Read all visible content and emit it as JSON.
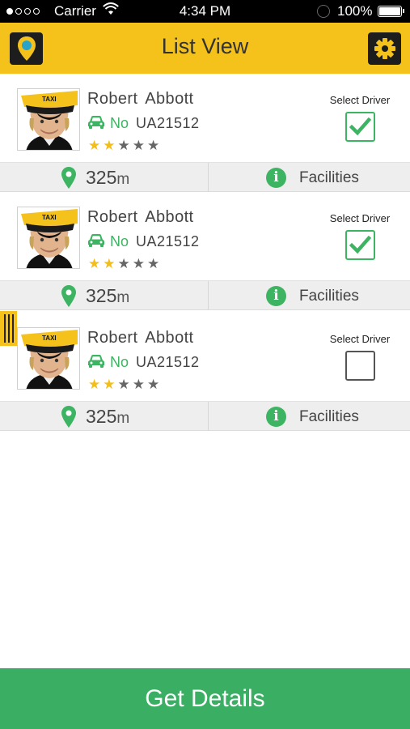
{
  "status_bar": {
    "carrier": "Carrier",
    "time": "4:34 PM",
    "battery": "100%"
  },
  "header": {
    "title": "List View",
    "left_icon": "map-pin-icon",
    "right_icon": "gear-icon"
  },
  "drivers": [
    {
      "name": "Robert  Abbott",
      "availability": "No",
      "plate": "UA21512",
      "rating": 2,
      "rating_max": 5,
      "select_label": "Select Driver",
      "selected": true,
      "distance": "325",
      "distance_unit": "m",
      "facilities_label": "Facilities"
    },
    {
      "name": "Robert  Abbott",
      "availability": "No",
      "plate": "UA21512",
      "rating": 2,
      "rating_max": 5,
      "select_label": "Select Driver",
      "selected": true,
      "distance": "325",
      "distance_unit": "m",
      "facilities_label": "Facilities"
    },
    {
      "name": "Robert  Abbott",
      "availability": "No",
      "plate": "UA21512",
      "rating": 2,
      "rating_max": 5,
      "select_label": "Select Driver",
      "selected": false,
      "distance": "325",
      "distance_unit": "m",
      "facilities_label": "Facilities"
    }
  ],
  "photo_cap_text": "TAXI",
  "footer": {
    "button_label": "Get Details"
  },
  "colors": {
    "accent": "#f5c21b",
    "green": "#3db462",
    "button_green": "#3aae63"
  }
}
